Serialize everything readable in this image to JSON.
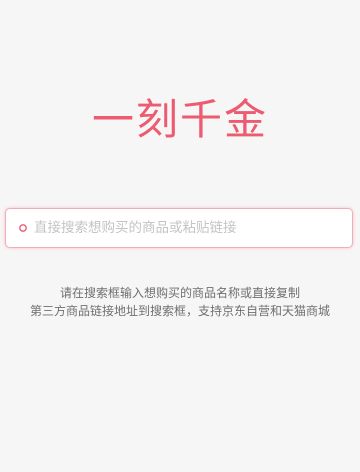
{
  "app": {
    "logo_text": "一刻千金",
    "brand_color": "#ec5b70"
  },
  "search": {
    "placeholder": "直接搜索想购买的商品或粘贴链接",
    "value": "",
    "icon": "search-dot-icon"
  },
  "hints": {
    "line1": "请在搜索框输入想购买的商品名称或直接复制",
    "line2": "第三方商品链接地址到搜索框，支持京东自营和天猫商城"
  }
}
